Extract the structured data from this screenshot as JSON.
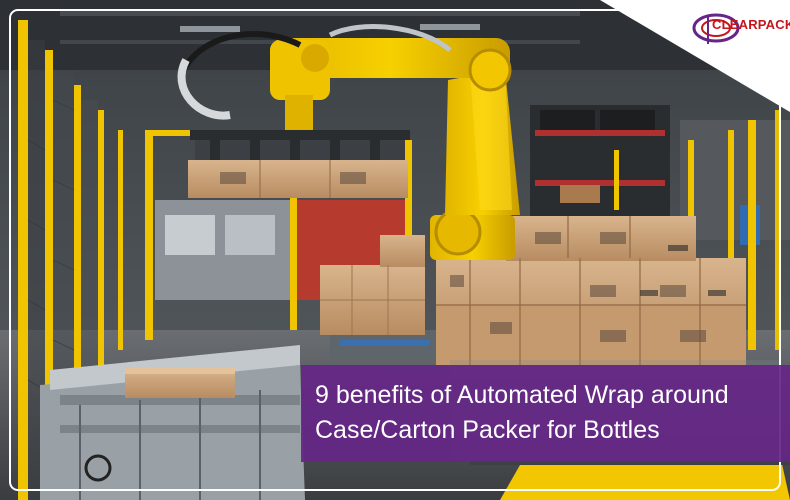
{
  "brand": {
    "name": "CLEARPACK",
    "accent": "#c4161c",
    "secondary": "#652687"
  },
  "headline": "9 benefits of Automated Wrap around Case/Carton Packer for Bottles",
  "colors": {
    "banner": "#652687",
    "robot": "#f2c700",
    "carton": "#c9a27a"
  }
}
